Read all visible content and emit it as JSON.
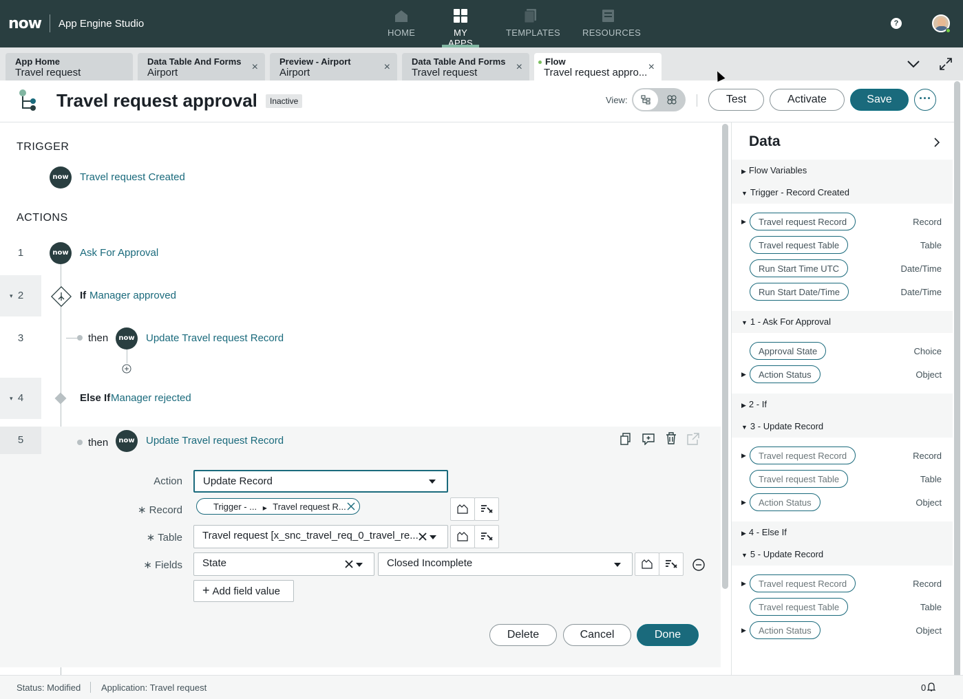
{
  "topnav": {
    "logo": "now",
    "app_name": "App Engine Studio",
    "items": [
      {
        "label": "HOME",
        "icon": "home-icon"
      },
      {
        "label": "MY APPS",
        "icon": "apps-grid-icon"
      },
      {
        "label": "TEMPLATES",
        "icon": "templates-icon"
      },
      {
        "label": "RESOURCES",
        "icon": "resources-icon"
      }
    ],
    "active_item": "MY APPS",
    "help_icon": "?"
  },
  "tabs": [
    {
      "title": "App Home",
      "subtitle": "Travel request",
      "closable": false
    },
    {
      "title": "Data Table And Forms",
      "subtitle": "Airport",
      "closable": true
    },
    {
      "title": "Preview - Airport",
      "subtitle": "Airport",
      "closable": true
    },
    {
      "title": "Data Table And Forms",
      "subtitle": "Travel request",
      "closable": true
    },
    {
      "title": "Flow",
      "subtitle": "Travel request appro...",
      "closable": true,
      "active": true
    }
  ],
  "tab_close": "×",
  "header": {
    "title": "Travel request approval",
    "status_badge": "Inactive",
    "view_label": "View:",
    "test_label": "Test",
    "activate_label": "Activate",
    "save_label": "Save",
    "more_label": "···"
  },
  "canvas": {
    "trigger_heading": "TRIGGER",
    "trigger_label": "Travel request Created",
    "actions_heading": "ACTIONS",
    "now_badge": "now",
    "rows": [
      {
        "num": "1",
        "text": "Ask For Approval"
      },
      {
        "num": "2",
        "keyword": "If",
        "text": "Manager approved"
      },
      {
        "num": "3",
        "then": "then",
        "text": "Update Travel request Record"
      },
      {
        "num": "4",
        "keyword": "Else If",
        "text": "Manager rejected"
      },
      {
        "num": "5",
        "then": "then",
        "text": "Update Travel request Record"
      }
    ],
    "form": {
      "action_label": "Action",
      "action_value": "Update Record",
      "record_label": "Record",
      "record_pill_1": "Trigger - ...",
      "record_pill_2": "Travel request R...",
      "table_label": "Table",
      "table_value": "Travel request [x_snc_travel_req_0_travel_re...",
      "fields_label": "Fields",
      "field_name": "State",
      "field_value": "Closed Incomplete",
      "add_field_label": "Add field value",
      "required_mark": "∗",
      "delete_label": "Delete",
      "cancel_label": "Cancel",
      "done_label": "Done"
    }
  },
  "data_panel": {
    "title": "Data",
    "sections": [
      {
        "title": "Flow Variables",
        "expanded": false,
        "items": []
      },
      {
        "title": "Trigger - Record Created",
        "expanded": true,
        "items": [
          {
            "label": "Travel request Record",
            "type": "Record",
            "expandable": true
          },
          {
            "label": "Travel request Table",
            "type": "Table",
            "expandable": false
          },
          {
            "label": "Run Start Time UTC",
            "type": "Date/Time",
            "expandable": false
          },
          {
            "label": "Run Start Date/Time",
            "type": "Date/Time",
            "expandable": false
          }
        ]
      },
      {
        "title": "1 - Ask For Approval",
        "expanded": true,
        "items": [
          {
            "label": "Approval State",
            "type": "Choice",
            "expandable": false
          },
          {
            "label": "Action Status",
            "type": "Object",
            "expandable": true
          }
        ]
      },
      {
        "title": "2 - If",
        "expanded": false,
        "items": []
      },
      {
        "title": "3 - Update Record",
        "expanded": true,
        "items": [
          {
            "label": "Travel request Record",
            "type": "Record",
            "expandable": true
          },
          {
            "label": "Travel request Table",
            "type": "Table",
            "expandable": false
          },
          {
            "label": "Action Status",
            "type": "Object",
            "expandable": true
          }
        ]
      },
      {
        "title": "4 - Else If",
        "expanded": false,
        "items": []
      },
      {
        "title": "5 - Update Record",
        "expanded": true,
        "items": [
          {
            "label": "Travel request Record",
            "type": "Record",
            "expandable": true
          },
          {
            "label": "Travel request Table",
            "type": "Table",
            "expandable": false
          },
          {
            "label": "Action Status",
            "type": "Object",
            "expandable": true
          }
        ]
      }
    ]
  },
  "status_bar": {
    "status": "Status: Modified",
    "application": "Application: Travel request",
    "notifications": "0"
  },
  "colors": {
    "nav_bg": "#293e40",
    "accent": "#1a6a7c",
    "link": "#1a6a7c"
  }
}
